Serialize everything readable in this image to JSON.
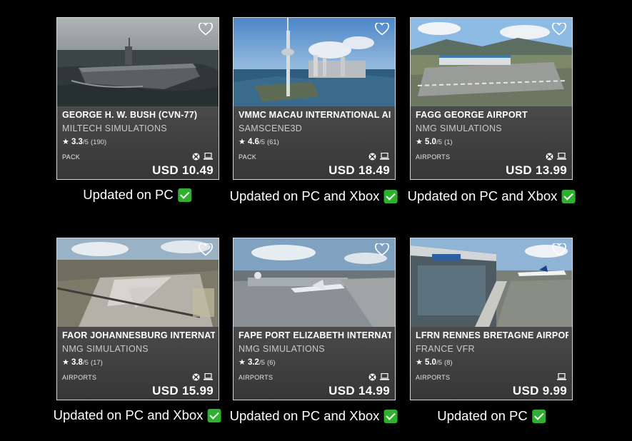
{
  "cards": [
    {
      "title": "GEORGE H. W. BUSH (CVN-77)",
      "publisher": "MILTECH SIMULATIONS",
      "rating": "3.3",
      "rating_max": "/5",
      "rating_count": "(190)",
      "category": "PACK",
      "price": "USD 10.49",
      "platforms": [
        "xbox",
        "pc"
      ],
      "caption": "Updated on PC",
      "scene": "carrier"
    },
    {
      "title": "VMMC MACAU INTERNATIONAL AIRPORT",
      "publisher": "SAMSCENE3D",
      "rating": "4.6",
      "rating_max": "/5",
      "rating_count": "(61)",
      "category": "PACK",
      "price": "USD 18.49",
      "platforms": [
        "xbox",
        "pc"
      ],
      "caption": "Updated on PC and Xbox",
      "scene": "city"
    },
    {
      "title": "FAGG GEORGE AIRPORT",
      "publisher": "NMG SIMULATIONS",
      "rating": "5.0",
      "rating_max": "/5",
      "rating_count": "(1)",
      "category": "AIRPORTS",
      "price": "USD 13.99",
      "platforms": [
        "xbox",
        "pc"
      ],
      "caption": "Updated on PC and Xbox",
      "scene": "airport-mountain"
    },
    {
      "title": "FAOR JOHANNESBURG INTERNATIONAL",
      "publisher": "NMG SIMULATIONS",
      "rating": "3.8",
      "rating_max": "/5",
      "rating_count": "(17)",
      "category": "AIRPORTS",
      "price": "USD 15.99",
      "platforms": [
        "xbox",
        "pc"
      ],
      "caption": "Updated on PC and Xbox",
      "scene": "airport-aerial"
    },
    {
      "title": "FAPE PORT ELIZABETH INTERNATIONAL",
      "publisher": "NMG SIMULATIONS",
      "rating": "3.2",
      "rating_max": "/5",
      "rating_count": "(6)",
      "category": "AIRPORTS",
      "price": "USD 14.99",
      "platforms": [
        "xbox",
        "pc"
      ],
      "caption": "Updated on PC and Xbox",
      "scene": "airport-jet"
    },
    {
      "title": "LFRN RENNES BRETAGNE AIRPORT",
      "publisher": "FRANCE VFR",
      "rating": "5.0",
      "rating_max": "/5",
      "rating_count": "(8)",
      "category": "AIRPORTS",
      "price": "USD 9.99",
      "platforms": [
        "pc"
      ],
      "caption": "Updated on PC",
      "scene": "terminal"
    }
  ],
  "colors": {
    "background": "#000000",
    "card_info": "#3a3a3a",
    "check": "#2fb12f"
  },
  "icons": {
    "favorite": "heart-icon",
    "xbox": "xbox-icon",
    "pc": "pc-icon",
    "star": "star-icon",
    "check": "check-icon"
  }
}
